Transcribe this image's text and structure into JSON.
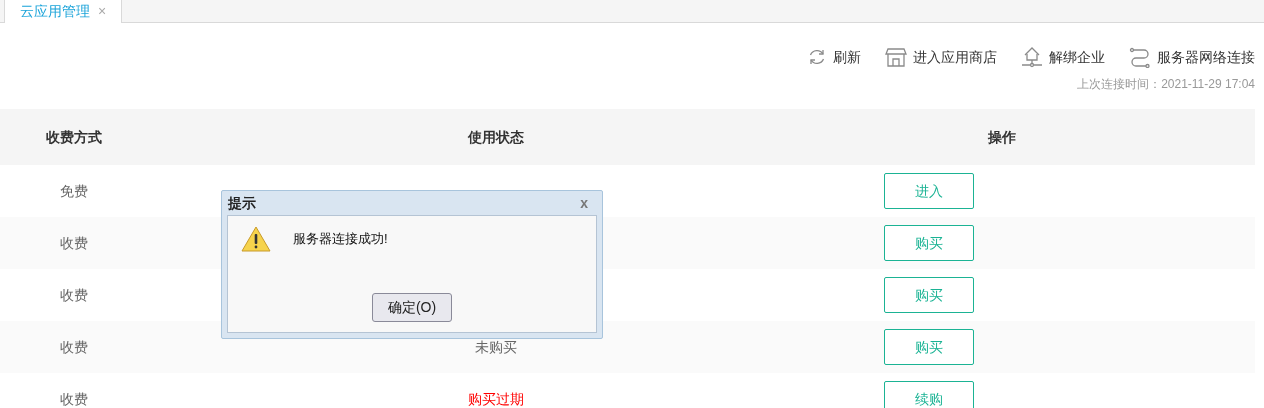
{
  "tabs": [
    {
      "label": "云应用管理",
      "selected": true,
      "close": "×"
    }
  ],
  "toolbar": [
    {
      "kind": "refresh",
      "label": "刷新"
    },
    {
      "kind": "store",
      "label": "进入应用商店"
    },
    {
      "kind": "unbind",
      "label": "解绑企业"
    },
    {
      "kind": "link",
      "label": "服务器网络连接"
    }
  ],
  "last_connected": "上次连接时间：2021-11-29 17:04",
  "table": {
    "columns": [
      "收费方式",
      "使用状态",
      "操作"
    ],
    "rows": [
      {
        "billing": "免费",
        "action": "进入"
      },
      {
        "billing": "收费",
        "action": "购买"
      },
      {
        "billing": "收费",
        "action": "购买"
      },
      {
        "billing": "收费",
        "status": "未购买",
        "expired": false,
        "action": "购买"
      },
      {
        "billing": "收费",
        "status": "购买过期",
        "expired": true,
        "action": "续购"
      }
    ]
  },
  "dialog": {
    "title": "提示",
    "close": "x",
    "message": "服务器连接成功!",
    "button": "确定(O)"
  }
}
